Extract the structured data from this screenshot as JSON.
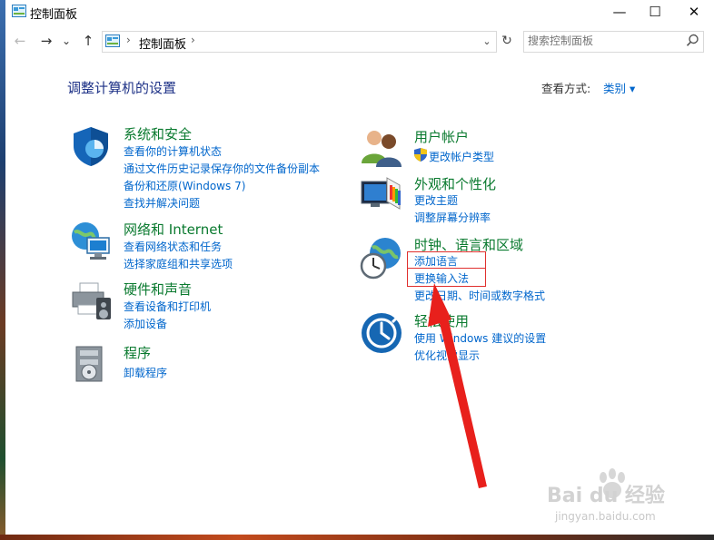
{
  "window": {
    "title": "控制面板",
    "controls": {
      "minimize": "—",
      "maximize": "☐",
      "close": "✕"
    }
  },
  "nav": {
    "back": "←",
    "forward": "→",
    "recent": "⌄",
    "up": "↑",
    "separator": "›",
    "address": "控制面板",
    "refresh": "↻",
    "search_placeholder": "搜索控制面板"
  },
  "main": {
    "heading": "调整计算机的设置",
    "view_by_label": "查看方式:",
    "view_by_value": "类别 ▾"
  },
  "categories": [
    {
      "title": "系统和安全",
      "icon": "shield-icon",
      "links": [
        "查看你的计算机状态",
        "通过文件历史记录保存你的文件备份副本",
        "备份和还原(Windows 7)",
        "查找并解决问题"
      ]
    },
    {
      "title": "网络和 Internet",
      "icon": "network-icon",
      "links": [
        "查看网络状态和任务",
        "选择家庭组和共享选项"
      ]
    },
    {
      "title": "硬件和声音",
      "icon": "printer-icon",
      "links": [
        "查看设备和打印机",
        "添加设备"
      ]
    },
    {
      "title": "程序",
      "icon": "programs-icon",
      "links": [
        "卸载程序"
      ]
    },
    {
      "title": "用户帐户",
      "icon": "users-icon",
      "links": [
        "更改帐户类型"
      ]
    },
    {
      "title": "外观和个性化",
      "icon": "display-icon",
      "links": [
        "更改主题",
        "调整屏幕分辨率"
      ]
    },
    {
      "title": "时钟、语言和区域",
      "icon": "clock-globe-icon",
      "links": [
        "添加语言",
        "更换输入法",
        "更改日期、时间或数字格式"
      ]
    },
    {
      "title": "轻松使用",
      "icon": "ease-of-access-icon",
      "links": [
        "使用 Windows 建议的设置",
        "优化视觉显示"
      ]
    }
  ],
  "watermark": {
    "brand": "Bai du 经验",
    "url": "jingyan.baidu.com"
  },
  "colors": {
    "category_title": "#0a7a2f",
    "link": "#0066cc",
    "heading": "#1e3287",
    "annotation": "#e0302e"
  }
}
